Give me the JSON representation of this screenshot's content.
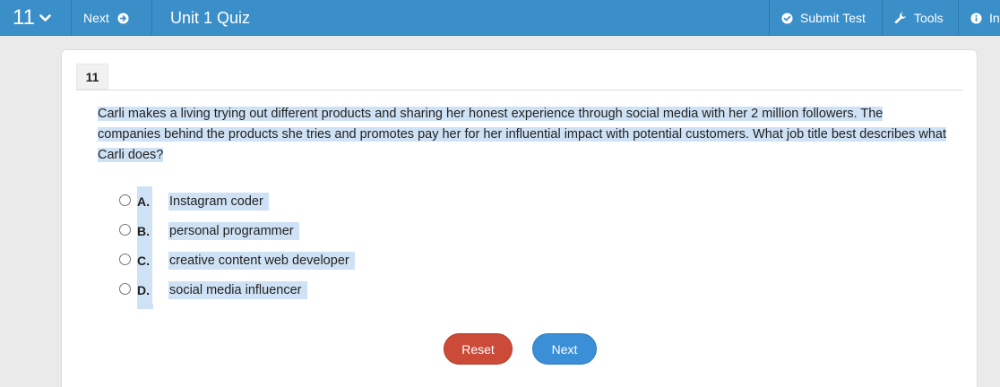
{
  "topbar": {
    "question_number": "11",
    "next_label": "Next",
    "title": "Unit 1 Quiz",
    "submit_label": "Submit Test",
    "tools_label": "Tools",
    "info_label": "Info"
  },
  "question": {
    "number": "11",
    "text": "Carli makes a living trying out different products and sharing her honest experience through social media with her 2 million followers. The companies behind the products she tries and promotes pay her for her influential impact with potential customers. What job title best describes what Carli does?",
    "options": [
      {
        "letter": "A.",
        "text": "Instagram coder"
      },
      {
        "letter": "B.",
        "text": "personal programmer"
      },
      {
        "letter": "C.",
        "text": "creative content web developer"
      },
      {
        "letter": "D.",
        "text": "social media influencer"
      }
    ]
  },
  "buttons": {
    "reset_label": "Reset",
    "next_label": "Next"
  },
  "colors": {
    "topbar": "#3b8fc9",
    "reset": "#cc4a38",
    "next": "#3b8fd6",
    "selection": "#cfe2f5"
  }
}
